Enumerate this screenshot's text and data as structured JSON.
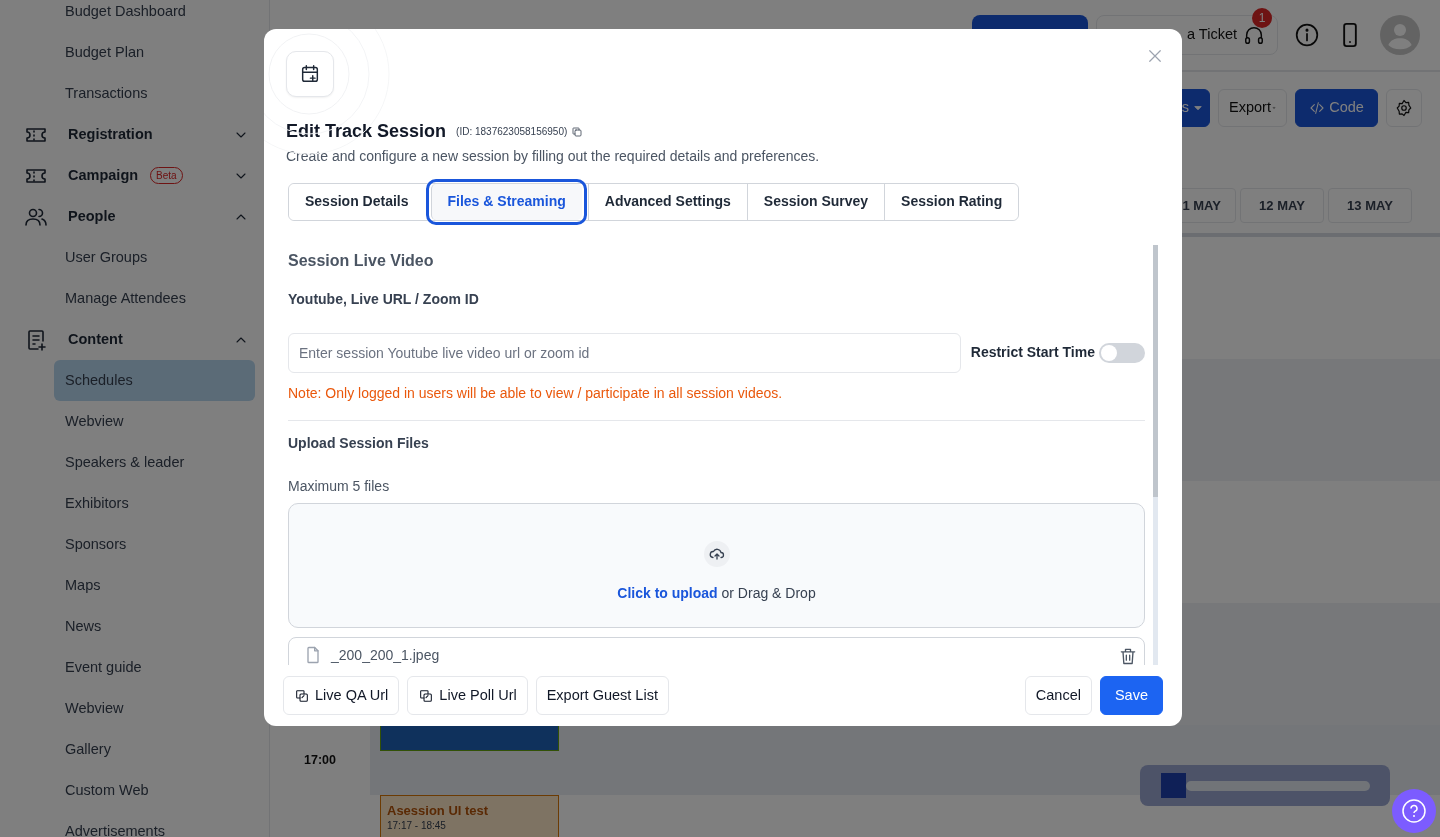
{
  "sidebar": {
    "items": [
      {
        "label": "Budget Dashboard",
        "kind": "sub",
        "selected": false
      },
      {
        "label": "Budget Plan",
        "kind": "sub",
        "selected": false
      },
      {
        "label": "Transactions",
        "kind": "sub",
        "selected": false
      },
      {
        "label": "Registration",
        "kind": "group",
        "expanded": false,
        "selected": false
      },
      {
        "label": "Campaign",
        "kind": "group",
        "expanded": false,
        "selected": false,
        "badge": "Beta"
      },
      {
        "label": "People",
        "kind": "group",
        "expanded": true,
        "selected": false
      },
      {
        "label": "User Groups",
        "kind": "sub",
        "selected": false
      },
      {
        "label": "Manage Attendees",
        "kind": "sub",
        "selected": false
      },
      {
        "label": "Content",
        "kind": "group",
        "expanded": true,
        "selected": false
      },
      {
        "label": "Schedules",
        "kind": "sub",
        "selected": true
      },
      {
        "label": "Webview",
        "kind": "sub",
        "selected": false
      },
      {
        "label": "Speakers & leader",
        "kind": "sub",
        "selected": false
      },
      {
        "label": "Exhibitors",
        "kind": "sub",
        "selected": false
      },
      {
        "label": "Sponsors",
        "kind": "sub",
        "selected": false
      },
      {
        "label": "Maps",
        "kind": "sub",
        "selected": false
      },
      {
        "label": "News",
        "kind": "sub",
        "selected": false
      },
      {
        "label": "Event guide",
        "kind": "sub",
        "selected": false
      },
      {
        "label": "Webview",
        "kind": "sub",
        "selected": false
      },
      {
        "label": "Gallery",
        "kind": "sub",
        "selected": false
      },
      {
        "label": "Custom Web",
        "kind": "sub",
        "selected": false
      },
      {
        "label": "Advertisements",
        "kind": "sub",
        "selected": false
      }
    ]
  },
  "topbar": {
    "ticket_button": "a Ticket",
    "notification_count": "1"
  },
  "toolbar": {
    "dropdown_label": "s",
    "export_label": "Export",
    "code_label": "Code"
  },
  "schedule": {
    "dates": [
      "1 MAY",
      "12 MAY",
      "13 MAY"
    ],
    "time": "17:00",
    "event": {
      "title": "Asession UI test",
      "time": "17:17 - 18:45"
    }
  },
  "modal": {
    "title": "Edit Track Session",
    "id_text": "(ID: 1837623058156950)",
    "subtitle": "Create and configure a new session by filling out the required details and preferences.",
    "tabs": [
      {
        "label": "Session Details",
        "selected": false
      },
      {
        "label": "Files & Streaming",
        "selected": true
      },
      {
        "label": "Advanced Settings",
        "selected": false
      },
      {
        "label": "Session Survey",
        "selected": false
      },
      {
        "label": "Session Rating",
        "selected": false
      }
    ],
    "live_video": {
      "heading": "Session Live Video",
      "label": "Youtube, Live URL / Zoom ID",
      "placeholder": "Enter session Youtube live video url or zoom id",
      "toggle_label": "Restrict Start Time",
      "restrict_start_time": false,
      "note": "Note: Only logged in users will be able to view / participate in all session videos."
    },
    "upload": {
      "heading": "Upload Session Files",
      "limit": "Maximum 5 files",
      "link": "Click to upload",
      "rest": "or Drag & Drop",
      "files": [
        "_200_200_1.jpeg"
      ]
    },
    "footer": {
      "left_buttons": [
        {
          "label": "Live QA Url",
          "kind": "copy"
        },
        {
          "label": "Live Poll Url",
          "kind": "copy"
        },
        {
          "label": "Export Guest List",
          "kind": "plain"
        }
      ],
      "cancel": "Cancel",
      "save": "Save"
    }
  }
}
